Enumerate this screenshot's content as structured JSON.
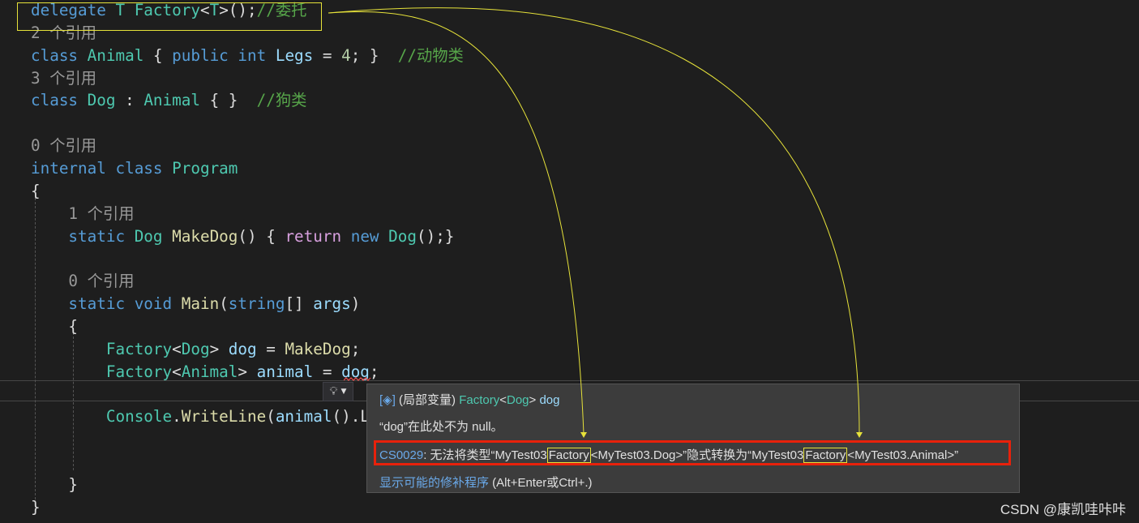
{
  "code_lines": [
    [
      [
        "delegate ",
        "kw"
      ],
      [
        "T ",
        "ty"
      ],
      [
        "Factory",
        "ty"
      ],
      [
        "<",
        "pl"
      ],
      [
        "T",
        "ty"
      ],
      [
        ">",
        "pl"
      ],
      [
        "();",
        "pl"
      ],
      [
        "//委托",
        "cm"
      ]
    ],
    [
      [
        "2 个引用",
        "ref"
      ]
    ],
    [
      [
        "class ",
        "kw"
      ],
      [
        "Animal",
        "ty"
      ],
      [
        " { ",
        "pl"
      ],
      [
        "public ",
        "kw"
      ],
      [
        "int ",
        "kw"
      ],
      [
        "Legs",
        "id"
      ],
      [
        " = ",
        "pl"
      ],
      [
        "4",
        "num"
      ],
      [
        "; }  ",
        "pl"
      ],
      [
        "//动物类",
        "cm"
      ]
    ],
    [
      [
        "3 个引用",
        "ref"
      ]
    ],
    [
      [
        "class ",
        "kw"
      ],
      [
        "Dog",
        "ty"
      ],
      [
        " : ",
        "pl"
      ],
      [
        "Animal",
        "ty"
      ],
      [
        " { }  ",
        "pl"
      ],
      [
        "//狗类",
        "cm"
      ]
    ],
    [],
    [
      [
        "0 个引用",
        "ref"
      ]
    ],
    [
      [
        "internal ",
        "kw"
      ],
      [
        "class ",
        "kw"
      ],
      [
        "Program",
        "ty"
      ]
    ],
    [
      [
        "{",
        "pl"
      ]
    ],
    [
      [
        "    1 个引用",
        "ref"
      ]
    ],
    [
      [
        "    static ",
        "kw"
      ],
      [
        "Dog ",
        "ty"
      ],
      [
        "MakeDog",
        "fn"
      ],
      [
        "() { ",
        "pl"
      ],
      [
        "return ",
        "ctl"
      ],
      [
        "new ",
        "kw"
      ],
      [
        "Dog",
        "ty"
      ],
      [
        "();}",
        "pl"
      ]
    ],
    [],
    [
      [
        "    0 个引用",
        "ref"
      ]
    ],
    [
      [
        "    static ",
        "kw"
      ],
      [
        "void ",
        "kw"
      ],
      [
        "Main",
        "fn"
      ],
      [
        "(",
        "pl"
      ],
      [
        "string",
        "kw"
      ],
      [
        "[] ",
        "pl"
      ],
      [
        "args",
        "id"
      ],
      [
        ")",
        "pl"
      ]
    ],
    [
      [
        "    {",
        "pl"
      ]
    ],
    [
      [
        "        Factory",
        "ty"
      ],
      [
        "<",
        "pl"
      ],
      [
        "Dog",
        "ty"
      ],
      [
        "> ",
        "pl"
      ],
      [
        "dog",
        "id"
      ],
      [
        " = ",
        "pl"
      ],
      [
        "MakeDog",
        "fn"
      ],
      [
        ";",
        "pl"
      ]
    ],
    [
      [
        "        Factory",
        "ty"
      ],
      [
        "<",
        "pl"
      ],
      [
        "Animal",
        "ty"
      ],
      [
        "> ",
        "pl"
      ],
      [
        "animal",
        "id"
      ],
      [
        " = ",
        "pl"
      ],
      [
        "dog",
        "id"
      ],
      [
        ";",
        "pl"
      ]
    ],
    [],
    [
      [
        "        Console",
        "ty"
      ],
      [
        ".",
        "pl"
      ],
      [
        "WriteLine",
        "fn"
      ],
      [
        "(",
        "pl"
      ],
      [
        "animal",
        "id"
      ],
      [
        "().L",
        "pl"
      ]
    ],
    [],
    [],
    [
      [
        "    }",
        "pl"
      ]
    ],
    [
      [
        "}",
        "pl"
      ]
    ]
  ],
  "quickinfo": {
    "kind": "(局部变量)",
    "type": "Factory",
    "lt": "<",
    "type_arg": "Dog",
    "gt": ">",
    "name": "dog",
    "null_state": "“dog”在此处不为 null。",
    "error_code": "CS0029",
    "error_p1": ": 无法将类型“MyTest03",
    "error_factory1": "Factory",
    "error_p2": "<MyTest03.Dog>”隐式转换为“MyTest03",
    "error_factory2": "Factory",
    "error_p3": "<MyTest03.Animal>”",
    "fix_link": "显示可能的修补程序",
    "fix_shortcut": " (Alt+Enter或Ctrl+.)"
  },
  "watermark": "CSDN @康凯哇咔咔",
  "colors": {
    "annotation": "#e6e23a",
    "error_box": "#e8210b"
  }
}
